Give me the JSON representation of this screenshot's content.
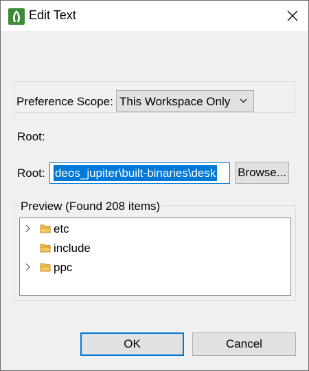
{
  "window": {
    "title": "Edit Text",
    "icon": "app-logo-icon",
    "close_icon": "close-icon"
  },
  "scope": {
    "label": "Preference Scope:",
    "selected": "This Workspace Only"
  },
  "root": {
    "static_label": "Root:",
    "label": "Root:",
    "value": "deos_jupiter\\built-binaries\\desk",
    "browse_label": "Browse..."
  },
  "preview": {
    "label": "Preview (Found 208 items)",
    "items": [
      {
        "label": "etc",
        "expandable": true
      },
      {
        "label": "include",
        "expandable": false
      },
      {
        "label": "ppc",
        "expandable": true
      }
    ]
  },
  "buttons": {
    "ok": "OK",
    "cancel": "Cancel"
  },
  "colors": {
    "accent": "#0078d7",
    "folder": "#e8a33d"
  }
}
